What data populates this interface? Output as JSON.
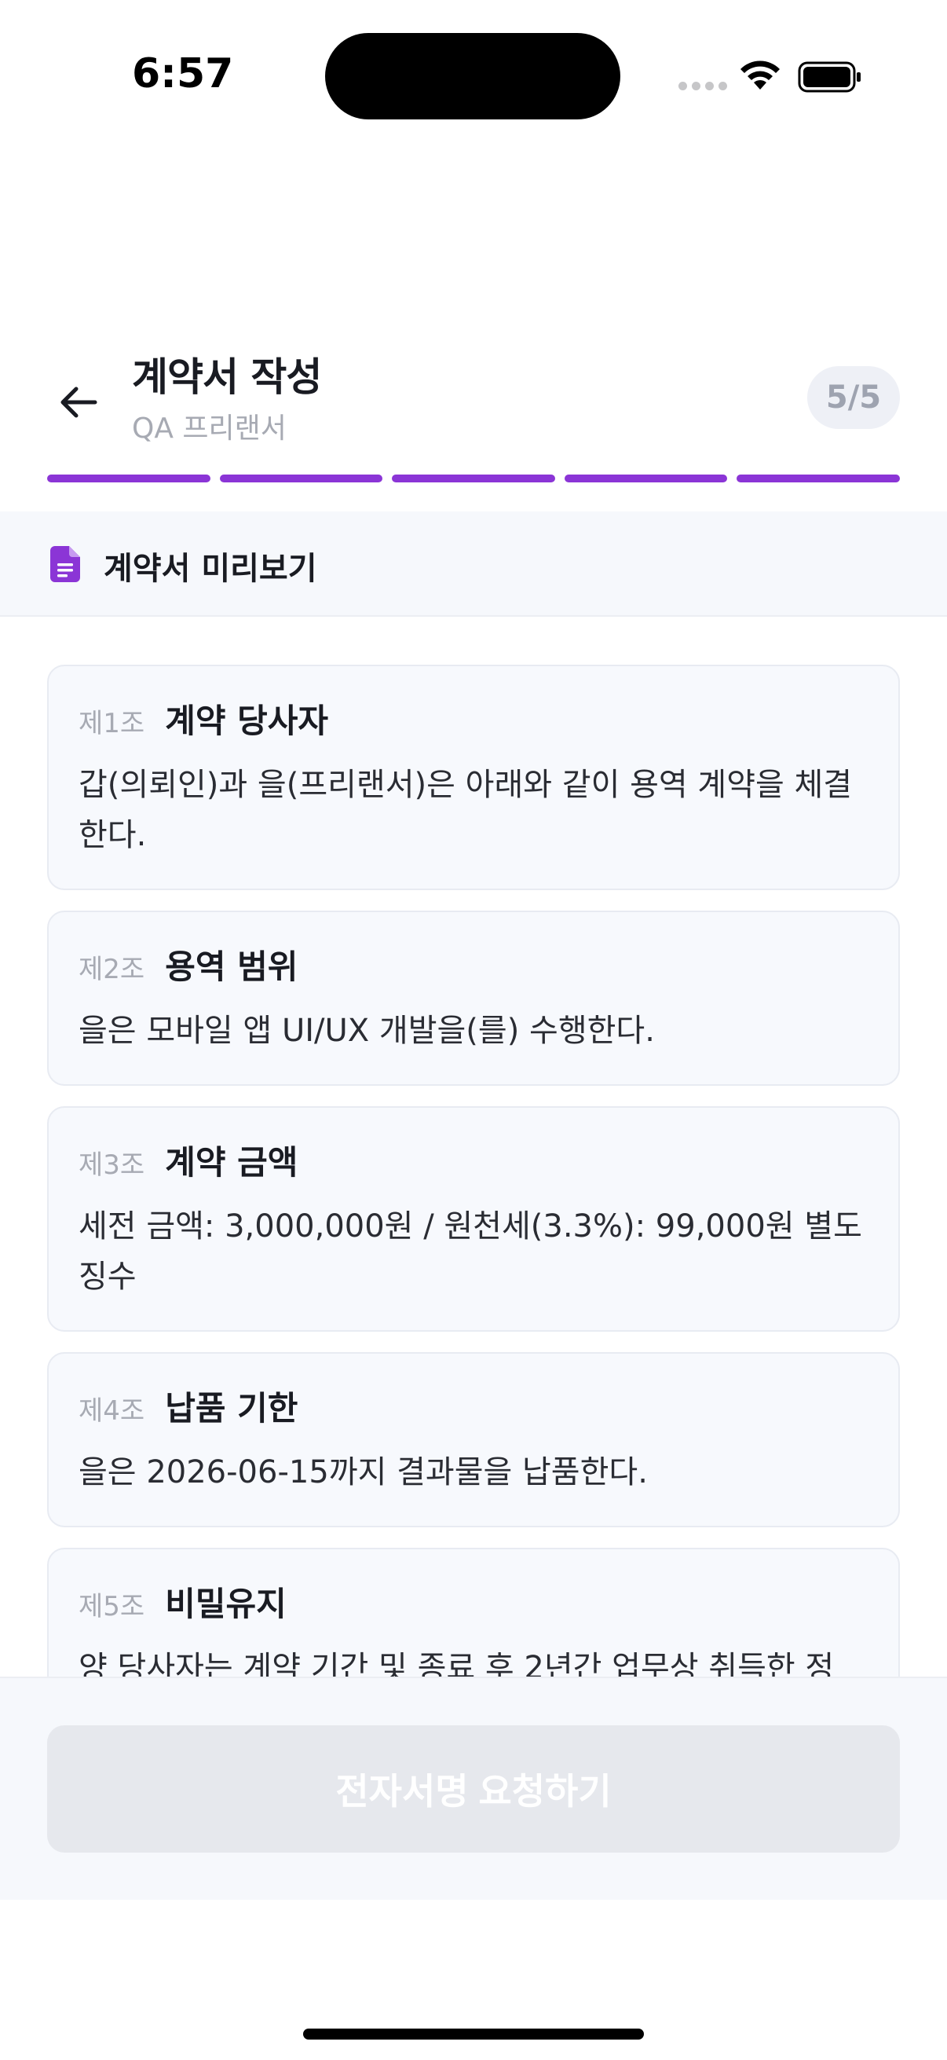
{
  "status_bar": {
    "time": "6:57"
  },
  "header": {
    "title": "계약서 작성",
    "subtitle": "QA 프리랜서",
    "step": "5/5"
  },
  "progress": {
    "total_steps": 5,
    "completed_steps": 5,
    "accent_color": "#8b35d6"
  },
  "preview": {
    "title": "계약서 미리보기",
    "icon": "document-icon"
  },
  "clauses": [
    {
      "no": "제1조",
      "title": "계약 당사자",
      "body": "갑(의뢰인)과 을(프리랜서)은 아래와 같이 용역 계약을 체결한다."
    },
    {
      "no": "제2조",
      "title": "용역 범위",
      "body": "을은 모바일 앱 UI/UX 개발을(를) 수행한다."
    },
    {
      "no": "제3조",
      "title": "계약 금액",
      "body": "세전 금액: 3,000,000원 / 원천세(3.3%): 99,000원 별도 징수"
    },
    {
      "no": "제4조",
      "title": "납품 기한",
      "body": "을은 2026-06-15까지 결과물을 납품한다."
    },
    {
      "no": "제5조",
      "title": "비밀유지",
      "body": "양 당사자는 계약 기간 및 종료 후 2년간 업무상 취득한 정"
    }
  ],
  "footer": {
    "sign_button_label": "전자서명 요청하기",
    "sign_button_enabled": false
  }
}
